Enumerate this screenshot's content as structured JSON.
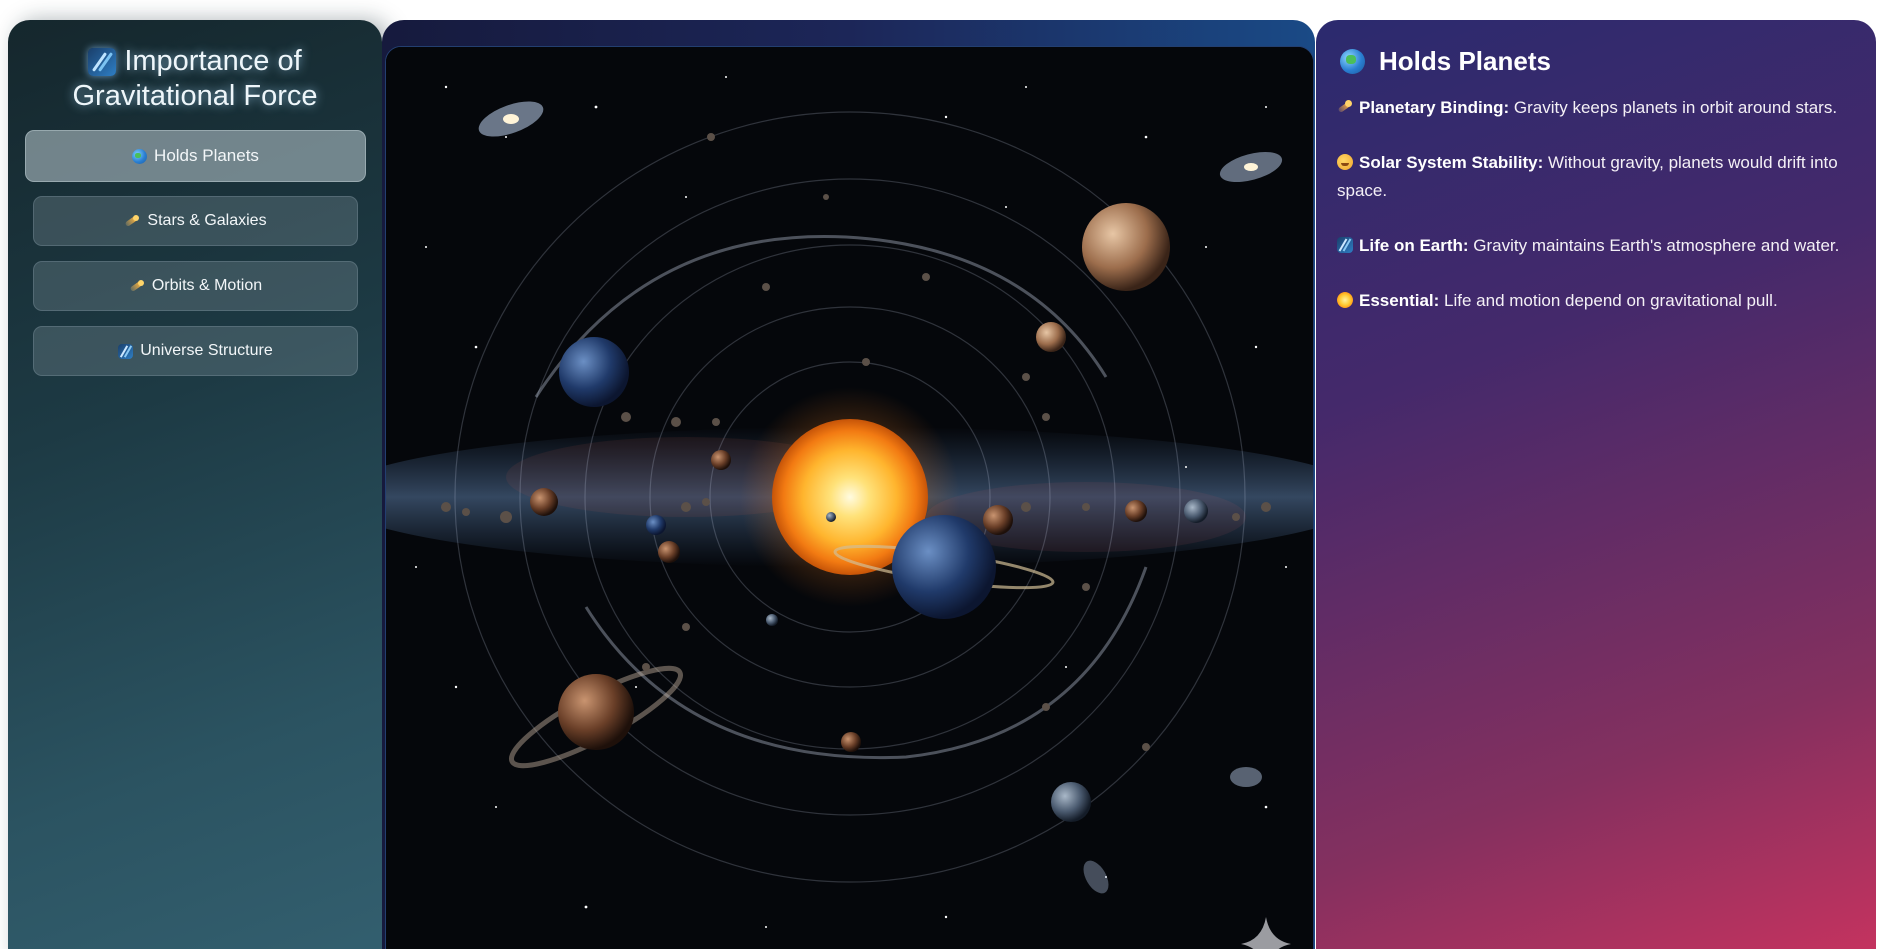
{
  "sidebar": {
    "title": "Importance of Gravitational Force",
    "title_icon": "milky-way-icon",
    "items": [
      {
        "label": "Holds Planets",
        "icon": "globe-icon",
        "active": true
      },
      {
        "label": "Stars & Galaxies",
        "icon": "comet-icon",
        "active": false
      },
      {
        "label": "Orbits & Motion",
        "icon": "comet-icon",
        "active": false
      },
      {
        "label": "Universe Structure",
        "icon": "milky-way-icon",
        "active": false
      }
    ]
  },
  "image_panel": {
    "alt": "Solar system illustration with the sun at the center and planets in orbit"
  },
  "content": {
    "title": "Holds Planets",
    "title_icon": "globe-icon",
    "points": [
      {
        "icon": "comet-icon",
        "term": "Planetary Binding:",
        "text": " Gravity keeps planets in orbit around stars."
      },
      {
        "icon": "smiling-face-icon",
        "term": "Solar System Stability:",
        "text": " Without gravity, planets would drift into space."
      },
      {
        "icon": "milky-way-icon",
        "term": "Life on Earth:",
        "text": " Gravity maintains Earth's atmosphere and water."
      },
      {
        "icon": "sun-icon",
        "term": "Essential:",
        "text": " Life and motion depend on gravitational pull."
      }
    ]
  },
  "colors": {
    "sidebar_bg": "#1d3a44",
    "image_frame": "#1c2658",
    "content_bg_start": "#2b2a6e",
    "content_bg_end": "#c6335f"
  }
}
